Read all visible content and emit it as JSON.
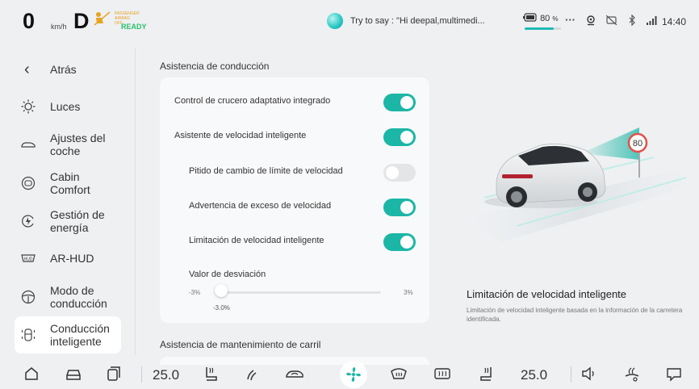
{
  "status": {
    "speed": "0",
    "speed_unit": "km/h",
    "gear": "D",
    "airbag_text": "PASSENGER AIRBAG OFF",
    "ready": "READY",
    "voice_hint": "Try to say : \"Hi deepal,multimedi...",
    "battery_percent": "80",
    "battery_unit": "%",
    "battery_level": 0.8,
    "time": "14:40",
    "icons": [
      "more-icon",
      "location-icon",
      "cast-icon",
      "bluetooth-icon",
      "signal-icon"
    ]
  },
  "sidebar": {
    "back_label": "Atrás",
    "items": [
      {
        "label": "Luces",
        "icon": "light-icon"
      },
      {
        "label": "Ajustes del coche",
        "icon": "car-icon"
      },
      {
        "label": "Cabin Comfort",
        "icon": "seat-icon"
      },
      {
        "label": "Gestión de energía",
        "icon": "energy-icon"
      },
      {
        "label": "AR-HUD",
        "icon": "hud-icon"
      },
      {
        "label": "Modo de conducción",
        "icon": "steering-icon"
      },
      {
        "label": "Conducción inteligente",
        "icon": "smart-drive-icon",
        "active": true
      }
    ]
  },
  "main": {
    "section1_title": "Asistencia de conducción",
    "rows": [
      {
        "label": "Control de crucero adaptativo integrado",
        "on": true
      },
      {
        "label": "Asistente de velocidad inteligente",
        "on": true
      },
      {
        "label": "Pitido de cambio de límite de velocidad",
        "on": false
      },
      {
        "label": "Advertencia de exceso de velocidad",
        "on": true
      },
      {
        "label": "Limitación de velocidad inteligente",
        "on": true
      }
    ],
    "slider": {
      "label": "Valor de desviación",
      "min": "-3%",
      "max": "3%",
      "value": "-3.0%"
    },
    "section2_title": "Asistencia de mantenimiento de carril",
    "illustration_sign": "80",
    "desc_title": "Limitación de velocidad inteligente",
    "desc_body": "Limitación de velocidad inteligente basada en la información de la carretera identificada."
  },
  "dock": {
    "left_temp": "25.0",
    "right_temp": "25.0"
  },
  "colors": {
    "accent": "#1bb6a6",
    "ready": "#2bbf6a",
    "background": "#eef0f2"
  }
}
